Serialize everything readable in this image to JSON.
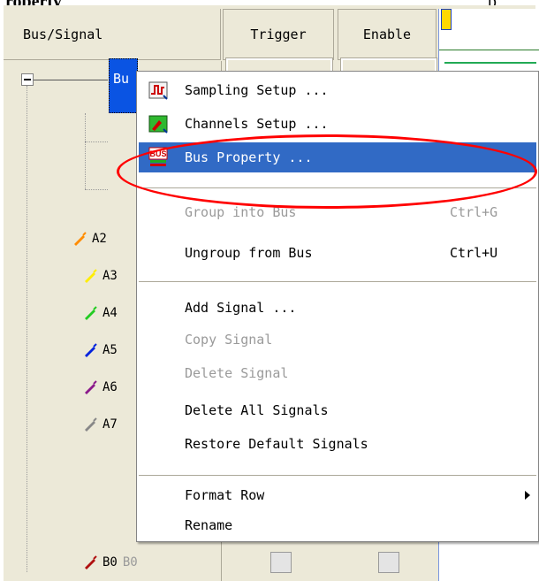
{
  "top_text": {
    "left": "roperty",
    "right": "p"
  },
  "header": {
    "bus_signal": "Bus/Signal",
    "trigger": "Trigger",
    "enable": "Enable"
  },
  "tree": {
    "bus_node_label": "Bu",
    "signals": [
      {
        "name": "A2",
        "color": "#ff8c00"
      },
      {
        "name": "A3",
        "color": "#ffee00"
      },
      {
        "name": "A4",
        "color": "#22cc22"
      },
      {
        "name": "A5",
        "color": "#0022dd"
      },
      {
        "name": "A6",
        "color": "#8b1a8b"
      },
      {
        "name": "A7",
        "color": "#888888"
      },
      {
        "name": "B0",
        "color": "#b01010",
        "alias": "B0"
      }
    ]
  },
  "context_menu": {
    "items": [
      {
        "label": "Sampling Setup ...",
        "icon": "sampling-setup-icon",
        "shortcut": "",
        "state": "enabled"
      },
      {
        "label": "Channels Setup ...",
        "icon": "channels-setup-icon",
        "shortcut": "",
        "state": "enabled"
      },
      {
        "label": "Bus Property ...",
        "icon": "bus-property-icon",
        "shortcut": "",
        "state": "selected"
      },
      {
        "label": "Group into Bus",
        "shortcut": "Ctrl+G",
        "state": "disabled"
      },
      {
        "label": "Ungroup from Bus",
        "shortcut": "Ctrl+U",
        "state": "enabled"
      },
      {
        "label": "Add Signal ...",
        "shortcut": "",
        "state": "enabled"
      },
      {
        "label": "Copy Signal",
        "shortcut": "",
        "state": "disabled"
      },
      {
        "label": "Delete Signal",
        "shortcut": "",
        "state": "disabled"
      },
      {
        "label": "Delete All Signals",
        "shortcut": "",
        "state": "enabled"
      },
      {
        "label": "Restore Default Signals",
        "shortcut": "",
        "state": "enabled"
      },
      {
        "label": "Format Row",
        "shortcut": "",
        "state": "enabled",
        "submenu": true
      },
      {
        "label": "Rename",
        "shortcut": "",
        "state": "enabled"
      }
    ]
  },
  "colors": {
    "highlight": "#316ac5",
    "annotation": "#ff0000",
    "panel": "#ece9d8"
  }
}
